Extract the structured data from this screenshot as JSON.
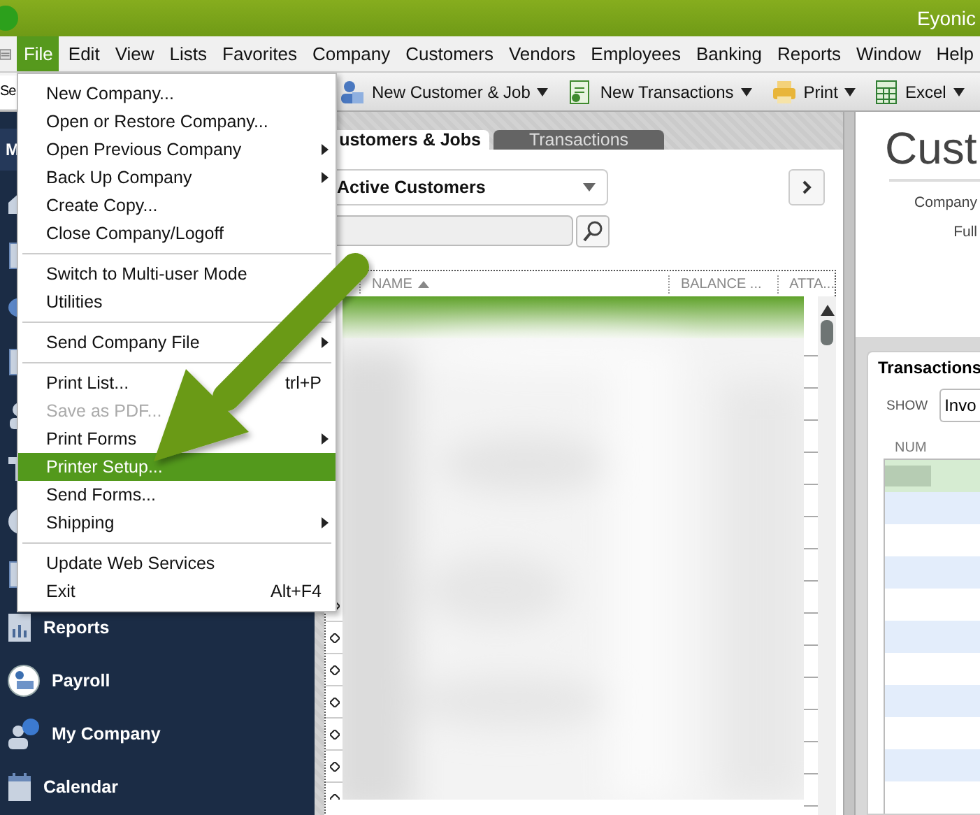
{
  "window": {
    "title": "Eyonic"
  },
  "menubar": [
    {
      "label": "File",
      "selected": true
    },
    {
      "label": "Edit",
      "selected": false
    },
    {
      "label": "View",
      "selected": false
    },
    {
      "label": "Lists",
      "selected": false
    },
    {
      "label": "Favorites",
      "selected": false
    },
    {
      "label": "Company",
      "selected": false
    },
    {
      "label": "Customers",
      "selected": false
    },
    {
      "label": "Vendors",
      "selected": false
    },
    {
      "label": "Employees",
      "selected": false
    },
    {
      "label": "Banking",
      "selected": false
    },
    {
      "label": "Reports",
      "selected": false
    },
    {
      "label": "Window",
      "selected": false
    },
    {
      "label": "Help",
      "selected": false
    }
  ],
  "toolbar": {
    "search_stub": "Se",
    "buttons": [
      {
        "label": "New Customer & Job",
        "kind": "person"
      },
      {
        "label": "New Transactions",
        "kind": "form"
      },
      {
        "label": "Print",
        "kind": "printer"
      },
      {
        "label": "Excel",
        "kind": "sheet"
      }
    ]
  },
  "file_menu": [
    {
      "kind": "item",
      "label": "New Company...",
      "submenu": false,
      "disabled": false,
      "selected": false
    },
    {
      "kind": "item",
      "label": "Open or Restore Company...",
      "submenu": false,
      "disabled": false,
      "selected": false
    },
    {
      "kind": "item",
      "label": "Open Previous Company",
      "submenu": true,
      "disabled": false,
      "selected": false
    },
    {
      "kind": "item",
      "label": "Back Up Company",
      "submenu": true,
      "disabled": false,
      "selected": false
    },
    {
      "kind": "item",
      "label": "Create Copy...",
      "submenu": false,
      "disabled": false,
      "selected": false
    },
    {
      "kind": "item",
      "label": "Close Company/Logoff",
      "submenu": false,
      "disabled": false,
      "selected": false
    },
    {
      "kind": "separator"
    },
    {
      "kind": "item",
      "label": "Switch to Multi-user Mode",
      "submenu": false,
      "disabled": false,
      "selected": false
    },
    {
      "kind": "item",
      "label": "Utilities",
      "submenu": false,
      "disabled": false,
      "selected": false
    },
    {
      "kind": "separator"
    },
    {
      "kind": "item",
      "label": "Send Company File",
      "submenu": true,
      "disabled": false,
      "selected": false
    },
    {
      "kind": "separator"
    },
    {
      "kind": "item",
      "label": "Print List...",
      "shortcut": "trl+P",
      "submenu": false,
      "disabled": false,
      "selected": false
    },
    {
      "kind": "item",
      "label": "Save as PDF...",
      "submenu": false,
      "disabled": true,
      "selected": false
    },
    {
      "kind": "item",
      "label": "Print Forms",
      "submenu": true,
      "disabled": false,
      "selected": false
    },
    {
      "kind": "item",
      "label": "Printer Setup...",
      "submenu": false,
      "disabled": false,
      "selected": true
    },
    {
      "kind": "item",
      "label": "Send Forms...",
      "submenu": false,
      "disabled": false,
      "selected": false
    },
    {
      "kind": "item",
      "label": "Shipping",
      "submenu": true,
      "disabled": false,
      "selected": false
    },
    {
      "kind": "separator"
    },
    {
      "kind": "item",
      "label": "Update Web Services",
      "submenu": false,
      "disabled": false,
      "selected": false
    },
    {
      "kind": "item",
      "label": "Exit",
      "shortcut": "Alt+F4",
      "submenu": false,
      "disabled": false,
      "selected": false
    }
  ],
  "sidebar": {
    "header": "M",
    "items": [
      {
        "label": "Reports",
        "kind": "reports"
      },
      {
        "label": "Payroll",
        "kind": "payroll"
      },
      {
        "label": "My Company",
        "kind": "company"
      },
      {
        "label": "Calendar",
        "kind": "calendar"
      }
    ]
  },
  "customer_center": {
    "tabs": [
      {
        "label": "ustomers & Jobs",
        "selected": true
      },
      {
        "label": "Transactions",
        "selected": false
      }
    ],
    "view_filter": "Active Customers",
    "columns": [
      {
        "label": "NAME",
        "sorted": true
      },
      {
        "label": "BALANCE ...",
        "sorted": false
      },
      {
        "label": "ATTA...",
        "sorted": false
      }
    ]
  },
  "detail": {
    "heading": "Cust",
    "fields": [
      "Company",
      "Full"
    ],
    "transactions": {
      "title": "Transactions",
      "show_label": "SHOW",
      "show_value": "Invo",
      "columns": [
        "NUM"
      ]
    }
  }
}
